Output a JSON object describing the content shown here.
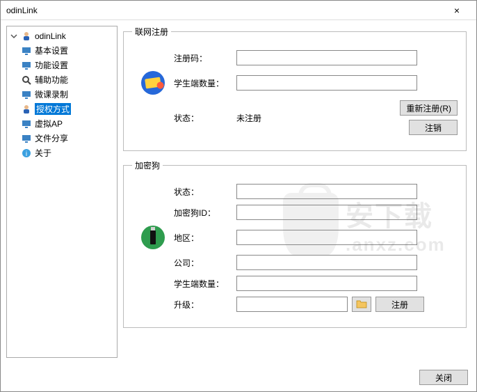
{
  "window": {
    "title": "odinLink",
    "close": "×"
  },
  "tree": {
    "root": "odinLink",
    "items": [
      {
        "label": "基本设置"
      },
      {
        "label": "功能设置"
      },
      {
        "label": "辅助功能"
      },
      {
        "label": "微课录制"
      },
      {
        "label": "授权方式",
        "selected": true
      },
      {
        "label": "虚拟AP"
      },
      {
        "label": "文件分享"
      },
      {
        "label": "关于"
      }
    ]
  },
  "section1": {
    "legend": "联网注册",
    "reg_code_label": "注册码：",
    "reg_code_value": "",
    "student_count_label": "学生端数量：",
    "student_count_value": "",
    "status_label": "状态：",
    "status_value": "未注册",
    "reregister_btn": "重新注册(R)",
    "logout_btn": "注销"
  },
  "section2": {
    "legend": "加密狗",
    "status_label": "状态：",
    "status_value": "",
    "dongle_id_label": "加密狗ID：",
    "dongle_id_value": "",
    "region_label": "地区：",
    "region_value": "",
    "company_label": "公司：",
    "company_value": "",
    "student_count_label": "学生端数量：",
    "student_count_value": "",
    "upgrade_label": "升级：",
    "upgrade_value": "",
    "register_btn": "注册"
  },
  "footer": {
    "close_btn": "关闭"
  },
  "watermark": {
    "text1": "安下载",
    "text2": ".anxz.com"
  }
}
